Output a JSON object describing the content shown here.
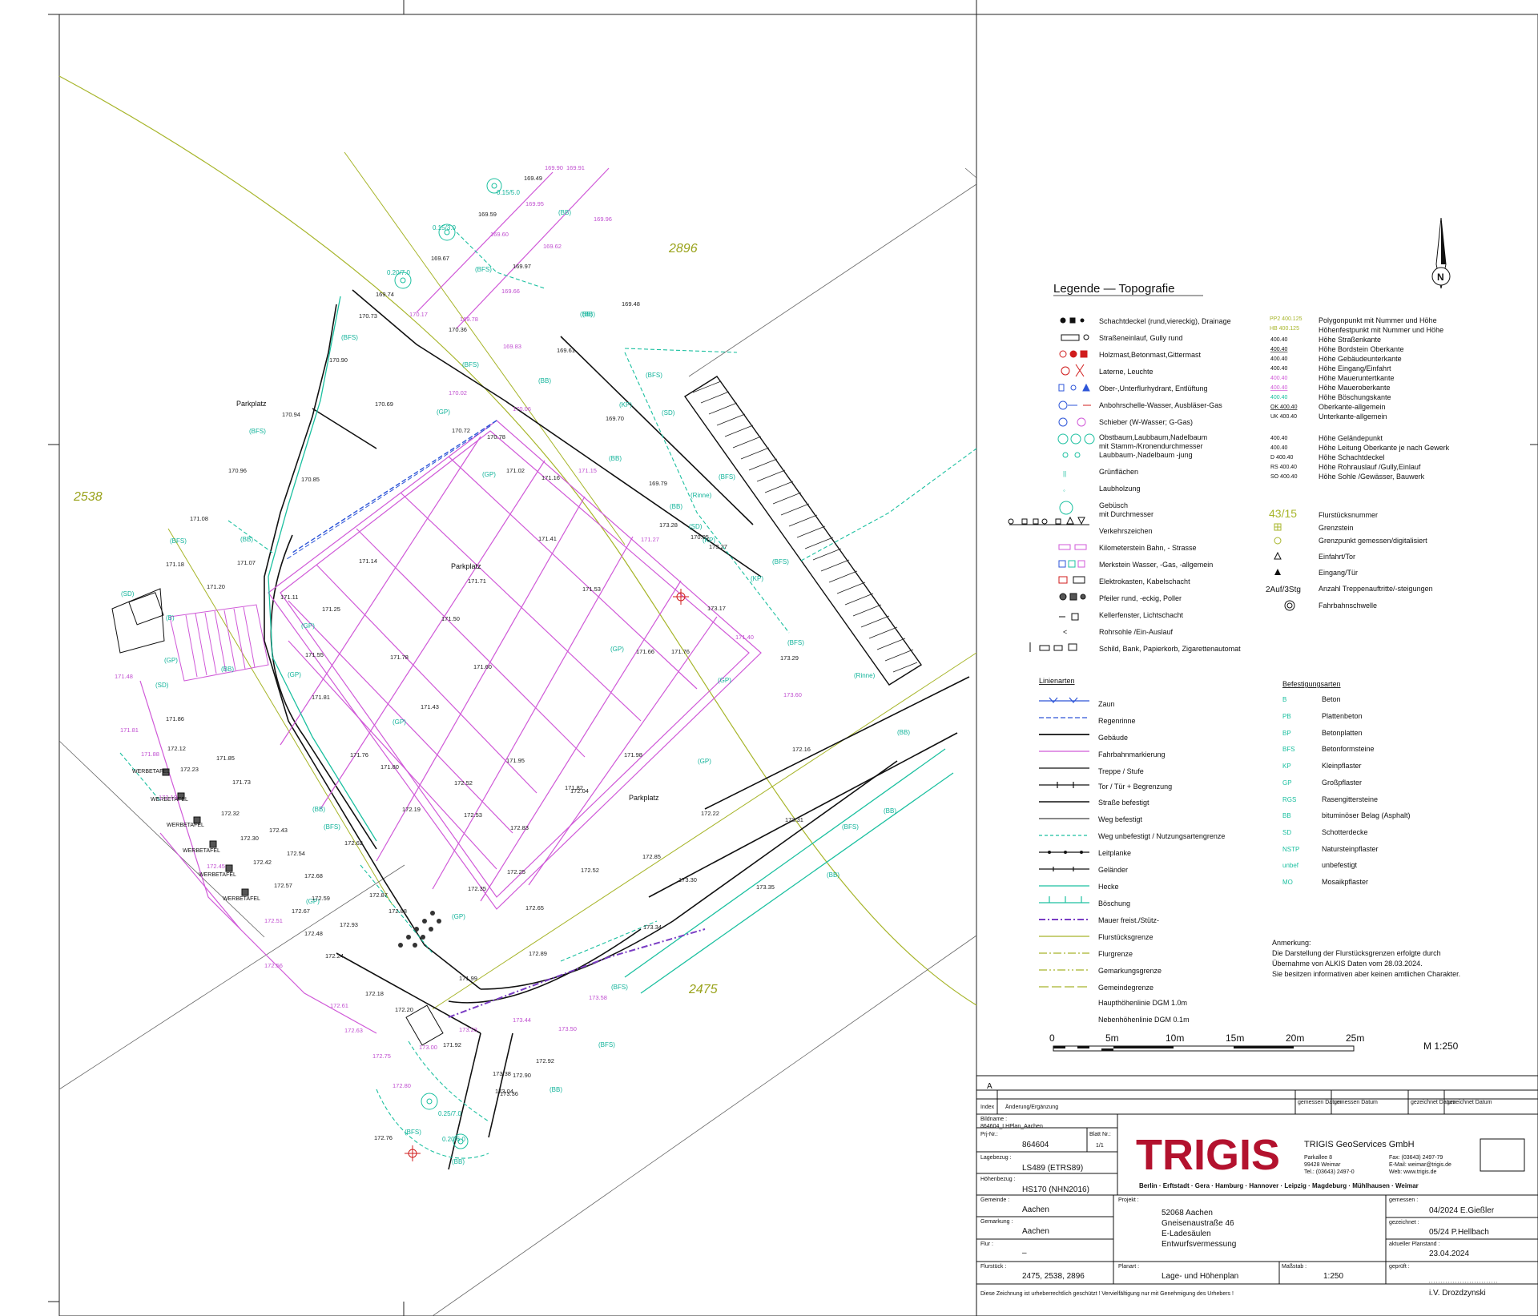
{
  "sheet": {
    "parcel_numbers": [
      "2896",
      "2538",
      "2475"
    ],
    "area_labels": [
      "Parkplatz",
      "Parkplatz",
      "Parkplatz"
    ],
    "surface_codes_on_map": [
      "(BB)",
      "(BFS)",
      "(GP)",
      "(SD)",
      "(KP)",
      "(B)",
      "(Rinne)"
    ],
    "billboard_label": "WERBETAFEL",
    "scale_text": "M 1:250",
    "scale_ticks": [
      "0",
      "5m",
      "10m",
      "15m",
      "20m",
      "25m"
    ],
    "frame_marker": "A"
  },
  "spot_heights": {
    "black": [
      "169.49",
      "169.59",
      "169.97",
      "169.67",
      "169.48",
      "169.74",
      "170.73",
      "170.36",
      "169.61",
      "170.94",
      "170.90",
      "170.69",
      "169.70",
      "170.72",
      "170.78",
      "170.96",
      "170.85",
      "171.08",
      "171.02",
      "171.16",
      "169.79",
      "171.18",
      "171.20",
      "171.11",
      "171.07",
      "171.14",
      "171.25",
      "171.41",
      "171.53",
      "171.71",
      "171.78",
      "171.50",
      "171.60",
      "171.55",
      "171.81",
      "171.43",
      "171.66",
      "171.76",
      "171.86",
      "172.12",
      "172.23",
      "171.85",
      "171.73",
      "171.76",
      "171.80",
      "171.82",
      "171.95",
      "171.98",
      "172.04",
      "172.16",
      "172.19",
      "172.52",
      "172.53",
      "172.83",
      "172.22",
      "172.25",
      "172.35",
      "172.52",
      "172.85",
      "172.65",
      "172.62",
      "172.87",
      "172.88",
      "172.93",
      "172.24",
      "172.48",
      "172.59",
      "172.67",
      "172.68",
      "172.57",
      "172.54",
      "172.43",
      "172.42",
      "172.32",
      "172.30",
      "172.18",
      "172.20",
      "171.99",
      "171.92",
      "172.89",
      "172.90",
      "172.92",
      "172.76",
      "173.04",
      "173.34",
      "173.31",
      "173.30",
      "173.35",
      "173.36",
      "173.38",
      "173.17",
      "173.29",
      "173.27",
      "173.28",
      "170.05",
      "171.35",
      "169.88",
      "169.70",
      "169.93"
    ],
    "magenta": [
      "169.90",
      "169.91",
      "169.95",
      "169.96",
      "169.60",
      "169.62",
      "169.66",
      "169.78",
      "169.83",
      "170.02",
      "170.06",
      "170.17",
      "171.15",
      "171.27",
      "171.40",
      "171.48",
      "171.81",
      "171.88",
      "172.10",
      "172.45",
      "172.51",
      "172.56",
      "172.61",
      "172.63",
      "172.75",
      "172.80",
      "173.00",
      "173.23",
      "173.44",
      "173.50",
      "173.58",
      "173.60"
    ],
    "cyan": [
      "0.15/5.0",
      "0.15/3.0",
      "0.20/7.0",
      "0.25/7.0",
      "0.20/6.0"
    ]
  },
  "legend": {
    "title": "Legende — Topografie",
    "topo_left": [
      "Schachtdeckel (rund,viereckig), Drainage",
      "Straßeneinlauf, Gully rund",
      "Holzmast,Betonmast,Gittermast",
      "Laterne, Leuchte",
      "Ober-,Unterflurhydrant, Entlüftung",
      "Anbohrschelle-Wasser, Ausbläser-Gas",
      "Schieber (W-Wasser; G-Gas)",
      "Obstbaum,Laubbaum,Nadelbaum",
      "mit Stamm-/Kronendurchmesser",
      "Laubbaum-,Nadelbaum -jung",
      "Grünflächen",
      "Laubholzung",
      "Gebüsch",
      "mit Durchmesser",
      "Verkehrszeichen",
      "Kilometerstein Bahn, - Strasse",
      "Merkstein Wasser, -Gas, -allgemein",
      "Elektrokasten, Kabelschacht",
      "Pfeiler rund, -eckig, Poller",
      "Kellerfenster, Lichtschacht",
      "Rohrsohle /Ein-Auslauf",
      "Schild, Bank, Papierkorb, Zigarettenautomat"
    ],
    "topo_right": [
      {
        "code": "PP2 400.125",
        "text": "Polygonpunkt mit Nummer und Höhe"
      },
      {
        "code": "HB 400.125",
        "text": "Höhenfestpunkt mit Nummer und Höhe"
      },
      {
        "code": "400.40",
        "text": "Höhe Straßenkante"
      },
      {
        "code": "400.40",
        "text": "Höhe Bordstein Oberkante"
      },
      {
        "code": "400.40",
        "text": "Höhe Gebäudeunterkante"
      },
      {
        "code": "400.40",
        "text": "Höhe Eingang/Einfahrt"
      },
      {
        "code": "400.40",
        "text": "Höhe Maueruntertkante"
      },
      {
        "code": "400.40",
        "text": "Höhe Maueroberkante"
      },
      {
        "code": "400.40",
        "text": "Höhe Böschungskante"
      },
      {
        "code": "OK 400.40",
        "text": "Oberkante-allgemein"
      },
      {
        "code": "UK 400.40",
        "text": "Unterkante-allgemein"
      },
      {
        "code": "400.40",
        "text": "Höhe Geländepunkt"
      },
      {
        "code": "400.40",
        "text": "Höhe Leitung Oberkante je nach Gewerk"
      },
      {
        "code": "D 400.40",
        "text": "Höhe Schachtdeckel"
      },
      {
        "code": "RS 400.40",
        "text": "Höhe Rohrauslauf /Gully,Einlauf"
      },
      {
        "code": "SO 400.40",
        "text": "Höhe Sohle /Gewässer, Bauwerk"
      }
    ],
    "flurstueck": [
      {
        "code": "43/15",
        "text": "Flurstücksnummer"
      },
      {
        "code": "",
        "text": "Grenzstein"
      },
      {
        "code": "",
        "text": "Grenzpunkt gemessen/digitalisiert"
      },
      {
        "code": "",
        "text": "Einfahrt/Tor"
      },
      {
        "code": "",
        "text": "Eingang/Tür"
      },
      {
        "code": "2Auf/3Stg",
        "text": "Anzahl Treppenauftritte/-steigungen"
      },
      {
        "code": "",
        "text": "Fahrbahnschwelle"
      }
    ],
    "linienarten_title": "Linienarten",
    "linienarten": [
      "Zaun",
      "Regenrinne",
      "Gebäude",
      "Fahrbahnmarkierung",
      "Treppe / Stufe",
      "Tor / Tür + Begrenzung",
      "Straße befestigt",
      "Weg befestigt",
      "Weg unbefestigt / Nutzungsartengrenze",
      "Leitplanke",
      "Geländer",
      "Hecke",
      "Böschung",
      "Mauer freist./Stütz-",
      "Flurstücksgrenze",
      "Flurgrenze",
      "Gemarkungsgrenze",
      "Gemeindegrenze",
      "Haupthöhenlinie DGM 1.0m",
      "Nebenhöhenlinie DGM 0.1m"
    ],
    "befestigung_title": "Befestigungsarten",
    "befestigung": [
      {
        "code": "B",
        "text": "Beton"
      },
      {
        "code": "PB",
        "text": "Plattenbeton"
      },
      {
        "code": "BP",
        "text": "Betonplatten"
      },
      {
        "code": "BFS",
        "text": "Betonformsteine"
      },
      {
        "code": "KP",
        "text": "Kleinpflaster"
      },
      {
        "code": "GP",
        "text": "Großpflaster"
      },
      {
        "code": "RGS",
        "text": "Rasengittersteine"
      },
      {
        "code": "BB",
        "text": "bituminöser Belag (Asphalt)"
      },
      {
        "code": "SD",
        "text": "Schotterdecke"
      },
      {
        "code": "NSTP",
        "text": "Natursteinpflaster"
      },
      {
        "code": "unbef",
        "text": "unbefestigt"
      },
      {
        "code": "MO",
        "text": "Mosaikpflaster"
      }
    ],
    "note_title": "Anmerkung:",
    "note_lines": [
      "Die Darstellung der Flurstücksgrenzen erfolgte durch",
      "Übernahme von ALKIS Daten vom 28.03.2024.",
      "Sie besitzen informativen aber keinen amtlichen Charakter."
    ]
  },
  "titleblock": {
    "rev_marker": "A",
    "rev_headers": {
      "index": "Index",
      "change": "Änderung/Ergänzung",
      "gemessen": "gemessen Datum",
      "gemessen2": "gemessen Datum",
      "gezeichnet": "gezeichnet Datum",
      "gezeichnet2": "gezeichnet Datum"
    },
    "bildname_label": "Bildname :",
    "bildname": "864604_LHPlan_Aachen",
    "prj_label": "Prj-Nr.:",
    "prj": "864604",
    "blatt_label": "Blatt Nr.:",
    "blatt": "1/1",
    "lagebezug_label": "Lagebezug :",
    "lagebezug": "LS489 (ETRS89)",
    "hoehenbezug_label": "Höhenbezug :",
    "hoehenbezug": "HS170 (NHN2016)",
    "company_logo": "TRIGIS",
    "company_name": "TRIGIS GeoServices GmbH",
    "address1": "Parkallee 8",
    "address2": "99428 Weimar",
    "tel": "Tel.: (03643) 2497-0",
    "fax": "Fax: (03643) 2497-79",
    "email": "E-Mail: weimar@trigis.de",
    "web": "Web: www.trigis.de",
    "offices": "Berlin · Erftstadt · Gera · Hamburg · Hannover · Leipzig · Magdeburg · Mühlhausen · Weimar",
    "gemeinde_label": "Gemeinde :",
    "gemeinde": "Aachen",
    "gemarkung_label": "Gemarkung :",
    "gemarkung": "Aachen",
    "flur_label": "Flur :",
    "flur": "–",
    "flurstueck_label": "Flurstück :",
    "flurstueck": "2475, 2538, 2896",
    "projekt_label": "Projekt :",
    "projekt_lines": [
      "52068 Aachen",
      "Gneisenaustraße 46",
      "E-Ladesäulen",
      "Entwurfsvermessung"
    ],
    "planart_label": "Planart :",
    "planart": "Lage- und Höhenplan",
    "massstab_label": "Maßstab :",
    "massstab": "1:250",
    "gemessen_label": "gemessen :",
    "gemessen": "04/2024 E.Gießler",
    "gezeichnet_label": "gezeichnet :",
    "gezeichnet": "05/24 P.Hellbach",
    "planstand_label": "aktueller Planstand :",
    "planstand": "23.04.2024",
    "geprueft_label": "geprüft :",
    "geprueft": "i.V. Drozdzynski",
    "copyright": "Diese Zeichnung ist urheberrechtlich geschützt !   Vervielfältigung nur mit Genehmigung des Urhebers !"
  },
  "colors": {
    "magenta": "#d05ad8",
    "cyan": "#1cc0a0",
    "green_boundary": "#a7b52a",
    "blue": "#2d55d8",
    "red": "#d01c1c",
    "logo_red": "#b3122e"
  }
}
